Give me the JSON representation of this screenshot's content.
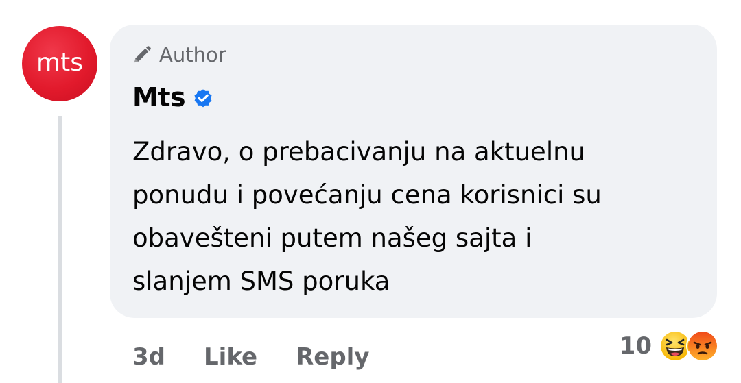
{
  "comment": {
    "avatar_text": "mts",
    "badge_label": "Author",
    "author_name": "Mts",
    "message_lines": [
      "Zdravo, o prebacivanju na aktuelnu",
      "ponudu i povećanju cena korisnici su",
      "obavešteni putem našeg sajta i",
      "slanjem SMS poruka"
    ],
    "time": "3d",
    "like_label": "Like",
    "reply_label": "Reply",
    "reaction_count": "10",
    "reactions": [
      "laughing-emoji-icon",
      "angry-emoji-icon"
    ]
  },
  "colors": {
    "brand_red": "#e21a2c",
    "bubble_bg": "#f0f2f5",
    "verified_blue": "#1877f2",
    "secondary_text": "#65676b"
  }
}
